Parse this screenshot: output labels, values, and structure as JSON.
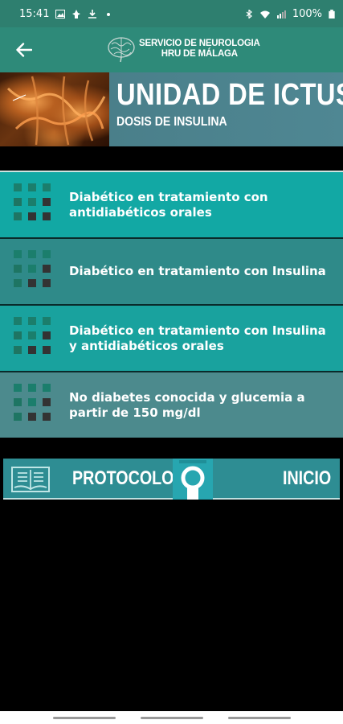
{
  "status_bar": {
    "time": "15:41",
    "battery": "100%"
  },
  "toolbar": {
    "brand_line1": "SERVICIO DE NEUROLOGIA",
    "brand_line2": "HRU DE MÁLAGA"
  },
  "banner": {
    "title": "UNIDAD DE ICTUS",
    "subtitle": "DOSIS DE INSULINA"
  },
  "menu": {
    "items": [
      {
        "label": "Diabético en tratamiento con antidiabéticos orales"
      },
      {
        "label": "Diabético en tratamiento con Insulina"
      },
      {
        "label": "Diabético en tratamiento con Insulina y antidiabéticos orales"
      },
      {
        "label": "No diabetes conocida y glucemia a partir de 150 mg/dl"
      }
    ]
  },
  "bottom_nav": {
    "protocols_label": "PROTOCOLOS",
    "home_label": "INICIO"
  },
  "colors": {
    "toolbar": "#2e8a79",
    "accent": "#12a8a4"
  }
}
